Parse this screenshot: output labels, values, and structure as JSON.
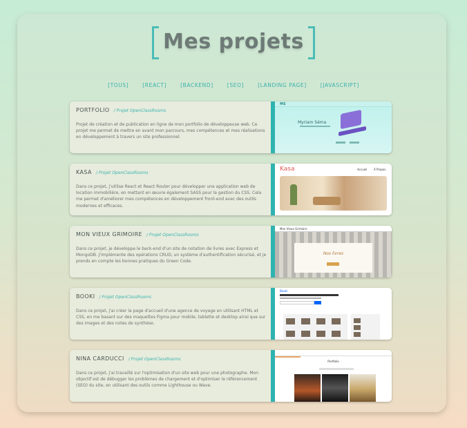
{
  "page": {
    "title": "Mes projets"
  },
  "filters": [
    "[TOUS]",
    "[REACT]",
    "[BACKEND]",
    "[SEO]",
    "[LANDING PAGE]",
    "[JAVASCRIPT]"
  ],
  "projects": [
    {
      "name": "PORTFOLIO",
      "tag": "/ Projet OpenClassRooms",
      "desc": "Projet de création et de publication en ligne de mon portfolio de développeuse web. Ce projet me permet de mettre en avant mon parcours, mes compétences et mes réalisations en développement à travers un site professionnel.",
      "thumb_title": "Myriam Séma"
    },
    {
      "name": "KASA",
      "tag": "/ Projet OpenClassRooms",
      "desc": "Dans ce projet, j'utilise React et React Router pour développer une application web de location immobilière, en mettant en œuvre également SASS pour la gestion du CSS. Cela me permet d'améliorer mes compétences en développement front-end avec des outils modernes et efficaces.",
      "thumb_logo": "Kasa",
      "thumb_nav": [
        "Accueil",
        "À Propos"
      ]
    },
    {
      "name": "MON VIEUX GRIMOIRE",
      "tag": "/ Projet OpenClassRooms",
      "desc": "Dans ce projet, je développe le back-end d'un site de notation de livres avec Express et MongoDB. J'implémente des opérations CRUD, un système d'authentification sécurisé, et je prends en compte les bonnes pratiques du Green Code.",
      "thumb_nav": "Mon Vieux Grimoire",
      "thumb_title": "Nos livres"
    },
    {
      "name": "BOOKI",
      "tag": "/ Projet OpenClassRooms",
      "desc": "Dans ce projet, j'ai créer la page d'accueil d'une agence de voyage en utilisant HTML et CSS, en me basant sur des maquettes Figma pour mobile, tablette et desktop ainsi que sur des images et des notes de synthèse.",
      "thumb_logo": "Booki"
    },
    {
      "name": "NINA CARDUCCI",
      "tag": "/ Projet OpenClassRooms",
      "desc": "Dans ce projet, j'ai travaillé sur l'optimisation d'un site web pour une photographe. Mon objectif est de débugger les problèmes de chargement et d'optimiser le référencement (SEO) du site, en utilisant des outils comme Lighthouse ou Wave.",
      "thumb_title": "Portfolio"
    }
  ],
  "colors": {
    "accent": "#2fb3b0",
    "title": "#6d7a76"
  }
}
